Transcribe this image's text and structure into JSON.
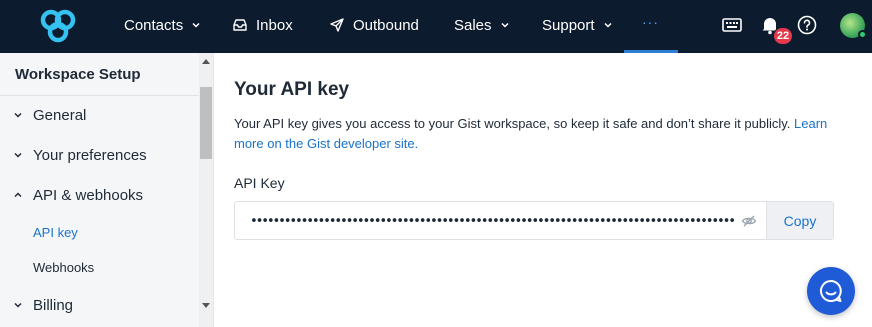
{
  "nav": {
    "items": [
      {
        "label": "Contacts",
        "has_dropdown": true
      },
      {
        "label": "Inbox",
        "icon": "inbox-icon"
      },
      {
        "label": "Outbound",
        "icon": "send-icon"
      },
      {
        "label": "Sales",
        "has_dropdown": true
      },
      {
        "label": "Support",
        "has_dropdown": true
      }
    ],
    "more_label": "···",
    "notification_count": "22",
    "accent_color": "#2d7fd3",
    "bg_color": "#0d1b2e"
  },
  "sidebar": {
    "title": "Workspace Setup",
    "items": [
      {
        "label": "General",
        "expanded": false
      },
      {
        "label": "Your preferences",
        "expanded": false
      },
      {
        "label": "API & webhooks",
        "expanded": true
      },
      {
        "label": "Billing",
        "expanded": false
      }
    ],
    "subitems": [
      {
        "label": "API key",
        "active": true
      },
      {
        "label": "Webhooks",
        "active": false
      }
    ]
  },
  "main": {
    "title": "Your API key",
    "description": "Your API key gives you access to your Gist workspace, so keep it safe and don’t share it publicly. ",
    "link_text": "Learn more on the Gist developer site.",
    "field_label": "API Key",
    "api_key_masked": "••••••••••••••••••••••••••••••••••••••••••••••••••••••••••••••••••••••••••••••••••••••",
    "copy_label": "Copy",
    "link_color": "#1a73c9"
  },
  "chat": {
    "icon": "chat-icon",
    "color": "#1f5bd6"
  }
}
